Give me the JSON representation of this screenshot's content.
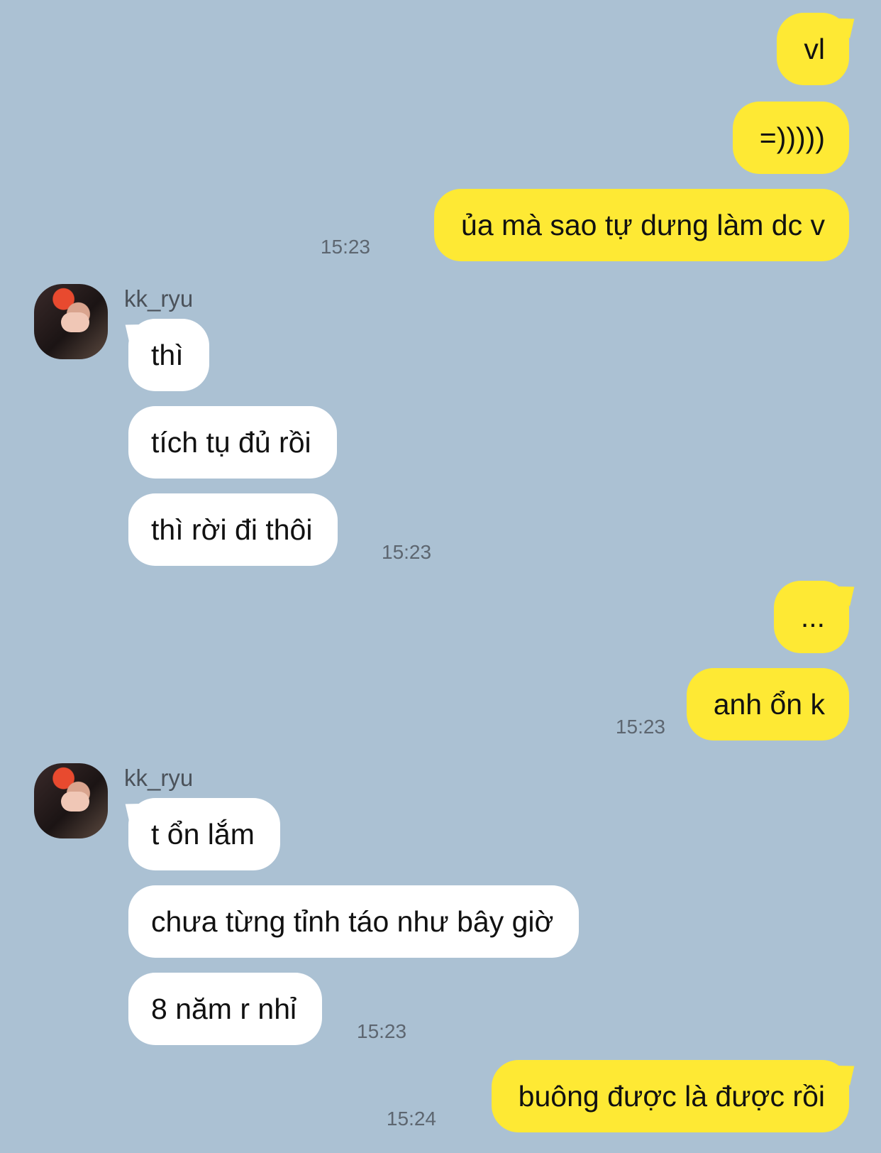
{
  "colors": {
    "background": "#abc1d3",
    "outgoing_bubble": "#fee934",
    "incoming_bubble": "#ffffff"
  },
  "messages": {
    "m1": "vl",
    "m2": "=)))))",
    "m3": "ủa mà sao tự dưng làm dc v",
    "t3": "15:23",
    "sender1": "kk_ryu",
    "m4": "thì",
    "m5": "tích tụ đủ rồi",
    "m6": "thì rời đi thôi",
    "t6": "15:23",
    "m7": "...",
    "m8": "anh ổn k",
    "t8": "15:23",
    "sender2": "kk_ryu",
    "m9": "t ổn lắm",
    "m10": "chưa từng tỉnh táo như bây giờ",
    "m11": "8 năm r nhỉ",
    "t11": "15:23",
    "m12": "buông được là được rồi",
    "t12": "15:24"
  }
}
